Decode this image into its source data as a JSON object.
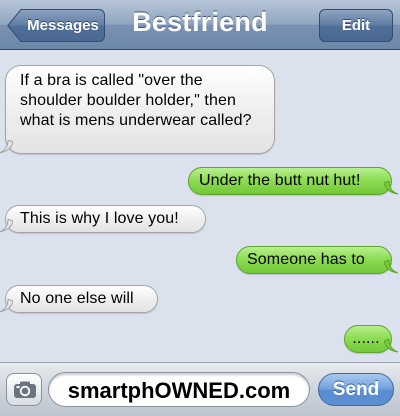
{
  "header": {
    "back_label": "Messages",
    "title": "Bestfriend",
    "edit_label": "Edit"
  },
  "messages": [
    {
      "from": "them",
      "text": "If a bra is called \"over the shoulder boulder holder,\" then what is mens underwear called?"
    },
    {
      "from": "me",
      "text": "Under the butt nut hut!"
    },
    {
      "from": "them",
      "text": "This is why I love you!"
    },
    {
      "from": "me",
      "text": "Someone has to"
    },
    {
      "from": "them",
      "text": "No one else will"
    },
    {
      "from": "me",
      "text": "......"
    }
  ],
  "composer": {
    "camera_icon": "camera-icon",
    "field_value": "smartphOWNED.com",
    "send_label": "Send"
  },
  "colors": {
    "incoming_bubble": "#eeeeee",
    "outgoing_bubble": "#8fdc56",
    "background": "#dbe2ed",
    "navbar": "#7a92b2"
  }
}
